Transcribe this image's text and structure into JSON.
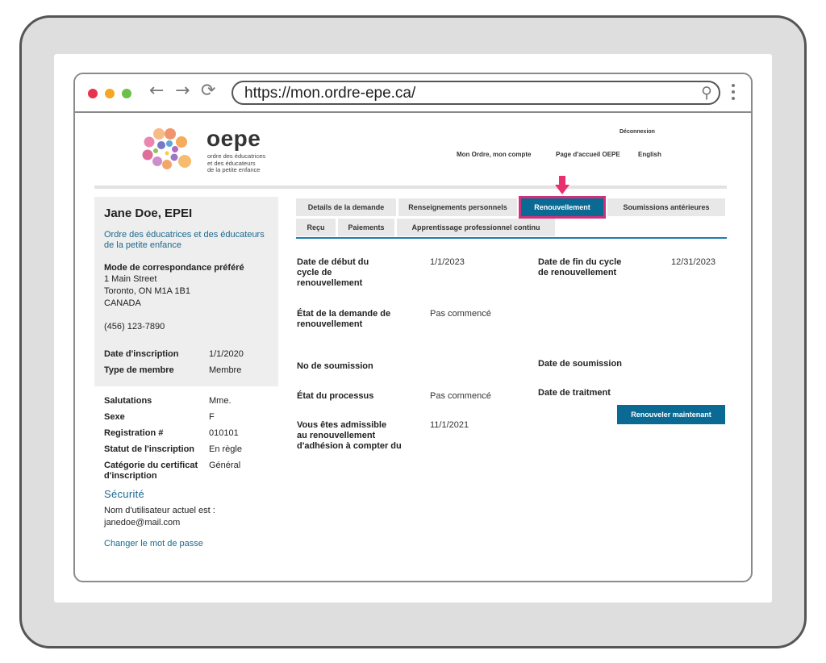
{
  "browser": {
    "url": "https://mon.ordre-epe.ca/",
    "dots": [
      "#e8344a",
      "#f5a623",
      "#6cc04a"
    ],
    "back": "←",
    "forward": "→",
    "reload": "⟳",
    "search_glyph": "⚲"
  },
  "site": {
    "logo_word": "oepe",
    "logo_sub": [
      "ordre des éducatrices",
      "et des éducateurs",
      "de la petite enfance"
    ],
    "logout": "Déconnexion",
    "topnav": [
      "Mon Ordre, mon compte",
      "Page d'accueil OEPE",
      "English"
    ]
  },
  "profile": {
    "name": "Jane Doe, EPEI",
    "org": "Ordre des éducatrices et des éducateurs de la petite enfance",
    "address_heading": "Mode de correspondance préféré",
    "address": [
      "1 Main Street",
      "Toronto, ON  M1A 1B1",
      "CANADA"
    ],
    "phone": "(456) 123-7890",
    "reg_date_label": "Date d'inscription",
    "reg_date": "1/1/2020",
    "member_type_label": "Type de membre",
    "member_type": "Membre",
    "details": [
      {
        "k": "Salutations",
        "v": "Mme."
      },
      {
        "k": "Sexe",
        "v": "F"
      },
      {
        "k": "Registration #",
        "v": "010101"
      },
      {
        "k": "Statut de l'inscription",
        "v": "En règle"
      }
    ],
    "cert_label_1": "Catégorie du certificat",
    "cert_label_2": "d'inscription",
    "cert_value": "Général",
    "security_heading": "Sécurité",
    "username_label": "Nom d'utilisateur actuel est :",
    "username": "janedoe@mail.com",
    "change_password": "Changer le mot de passe"
  },
  "tabs": {
    "row1": [
      "Details de la demande",
      "Renseignements personnels",
      "Renouvellement",
      "Soumissions antérieures"
    ],
    "row2": [
      "Reçu",
      "Paiements",
      "Apprentissage professionnel continu"
    ],
    "active": "Renouvellement"
  },
  "renewal": {
    "start_label": [
      "Date de début du",
      "cycle de",
      "renouvellement"
    ],
    "start_value": "1/1/2023",
    "end_label": [
      "Date de fin du cycle",
      "de renouvellement"
    ],
    "end_value": "12/31/2023",
    "state_label": [
      "État de la demande de",
      "renouvellement"
    ],
    "state_value": "Pas commencé",
    "submission_no_label": "No de soumission",
    "submission_date_label": "Date de soumission",
    "process_label": "État du processus",
    "process_value": "Pas commencé",
    "processing_date_label": "Date de traitment",
    "eligible_label": [
      "Vous êtes admissible",
      "au renouvellement",
      "d'adhésion à compter du"
    ],
    "eligible_value": "11/1/2021",
    "renew_button": "Renouveler maintenant"
  },
  "colors": {
    "accent": "#0b6a94",
    "highlight": "#d0317b",
    "link": "#1a6a8f"
  }
}
